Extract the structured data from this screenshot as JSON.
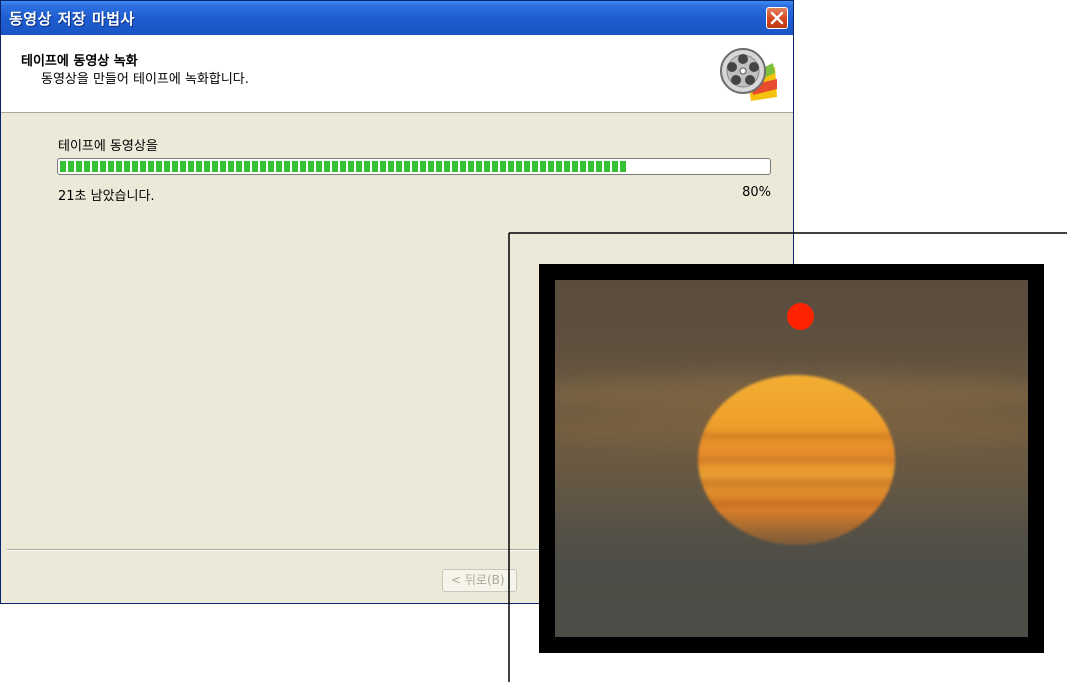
{
  "window": {
    "title": "동영상 저장 마법사",
    "close_icon": "close-icon"
  },
  "header": {
    "title": "테이프에 동영상 녹화",
    "subtitle": "동영상을 만들어 테이프에 녹화합니다.",
    "icon": "film-reel-icon"
  },
  "progress": {
    "label": "테이프에 동영상을",
    "fraction": 0.8,
    "remaining": "21초 남았습니다.",
    "percent": "80%",
    "fill_color": "#33C233"
  },
  "footer": {
    "back_label": "< 뒤로(B)"
  },
  "preview": {
    "record_indicator_color": "#FF2200",
    "scene": "sunset-video-frame"
  }
}
